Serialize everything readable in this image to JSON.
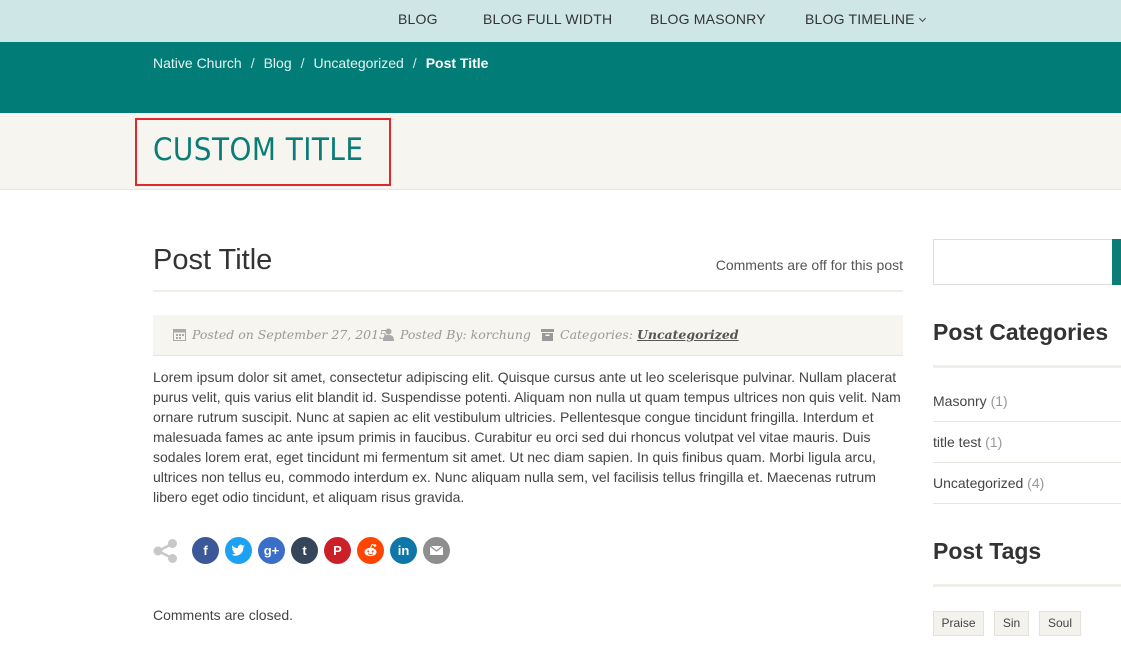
{
  "nav": {
    "items": [
      "BLOG",
      "BLOG FULL WIDTH",
      "BLOG MASONRY",
      "BLOG TIMELINE"
    ]
  },
  "breadcrumb": {
    "items": [
      "Native Church",
      "Blog",
      "Uncategorized"
    ],
    "separator": "/",
    "current": "Post Title"
  },
  "page": {
    "custom_title": "CUSTOM TITLE"
  },
  "post": {
    "title": "Post Title",
    "comments_status": "Comments are off for this post",
    "meta": {
      "posted_on": "Posted on September 27, 2015",
      "posted_by": "Posted By: korchung",
      "categories_label": "Categories:",
      "category": "Uncategorized"
    },
    "body": "Lorem ipsum dolor sit amet, consectetur adipiscing elit. Quisque cursus ante ut leo scelerisque pulvinar. Nullam placerat purus velit, quis varius elit blandit id. Suspendisse potenti. Aliquam non nulla ut quam tempus ultrices non quis velit. Nam ornare rutrum suscipit. Nunc at sapien ac elit vestibulum ultricies. Pellentesque congue tincidunt fringilla. Interdum et malesuada fames ac ante ipsum primis in faucibus. Curabitur eu orci sed dui rhoncus volutpat vel vitae mauris. Duis sodales lorem erat, eget tincidunt mi fermentum sit amet. Ut nec diam sapien. In quis finibus quam. Morbi ligula arcu, ultrices non tellus eu, commodo interdum ex. Nunc aliquam nulla sem, vel facilisis tellus fringilla et. Maecenas rutrum libero eget odio tincidunt, et aliquam risus gravida.",
    "comments_closed": "Comments are closed."
  },
  "share": {
    "buttons": [
      {
        "name": "facebook",
        "glyph": "f",
        "color": "#3b5998"
      },
      {
        "name": "twitter",
        "glyph": "",
        "color": "#1da1f2"
      },
      {
        "name": "google-plus",
        "glyph": "g+",
        "color": "#3a6ec8"
      },
      {
        "name": "tumblr",
        "glyph": "t",
        "color": "#35465c"
      },
      {
        "name": "pinterest",
        "glyph": "P",
        "color": "#cb2027"
      },
      {
        "name": "reddit",
        "glyph": "",
        "color": "#ff4500"
      },
      {
        "name": "linkedin",
        "glyph": "in",
        "color": "#0e76a8"
      },
      {
        "name": "email",
        "glyph": "",
        "color": "#8e8e8e"
      }
    ]
  },
  "sidebar": {
    "search_placeholder": "",
    "categories_title": "Post Categories",
    "categories": [
      {
        "label": "Masonry",
        "count": "(1)"
      },
      {
        "label": "title test",
        "count": "(1)"
      },
      {
        "label": "Uncategorized",
        "count": "(4)"
      }
    ],
    "tags_title": "Post Tags",
    "tags": [
      "Praise",
      "Sin",
      "Soul"
    ]
  },
  "colors": {
    "brand_teal": "#017c76",
    "nav_bg": "#cfe6e6",
    "title_highlight": "#e0282e"
  }
}
